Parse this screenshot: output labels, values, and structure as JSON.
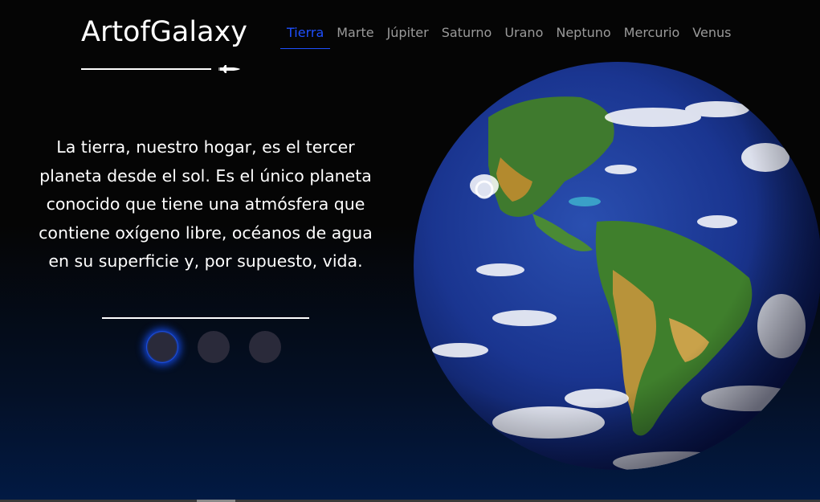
{
  "brand": {
    "name": "ArtofGalaxy",
    "icon": "space-shuttle-icon"
  },
  "nav": {
    "items": [
      {
        "label": "Tierra",
        "active": true
      },
      {
        "label": "Marte",
        "active": false
      },
      {
        "label": "Júpiter",
        "active": false
      },
      {
        "label": "Saturno",
        "active": false
      },
      {
        "label": "Urano",
        "active": false
      },
      {
        "label": "Neptuno",
        "active": false
      },
      {
        "label": "Mercurio",
        "active": false
      },
      {
        "label": "Venus",
        "active": false
      }
    ]
  },
  "content": {
    "description": "La tierra, nuestro hogar, es el tercer planeta desde el sol. Es el único planeta conocido que tiene una atmósfera que contiene oxígeno libre, océanos de agua en su superficie y, por supuesto, vida."
  },
  "carousel": {
    "slide_count": 3,
    "active_index": 0
  },
  "colors": {
    "accent": "#1e4fff",
    "background": "#050505",
    "nav_text": "#9a9a9a"
  }
}
